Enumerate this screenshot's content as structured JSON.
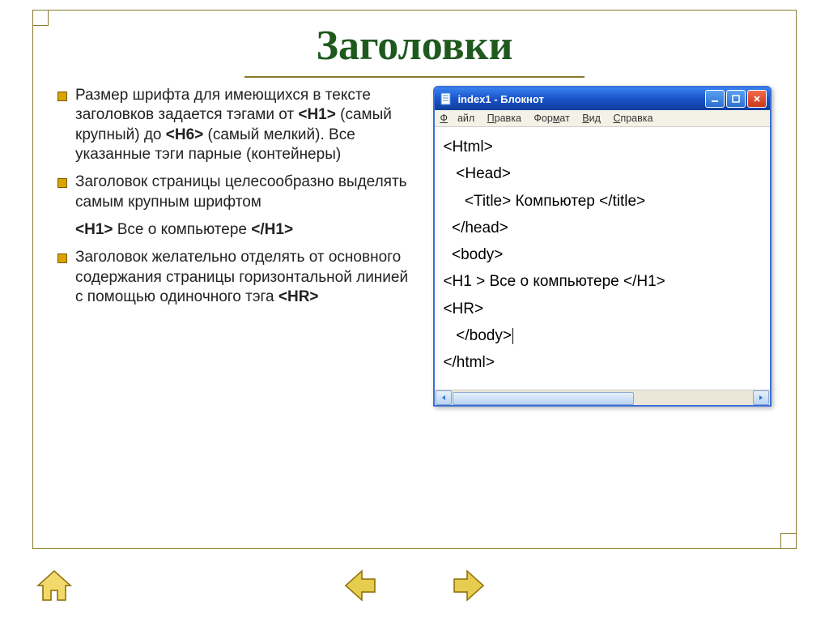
{
  "slide": {
    "title": "Заголовки"
  },
  "bullets": {
    "b1_pre": "Размер шрифта для имеющихся в тексте заголовков задается тэгами от ",
    "b1_tag1": "<H1>",
    "b1_mid": " (самый крупный) до ",
    "b1_tag2": "<H6>",
    "b1_post": " (самый мелкий). Все указанные тэги парные (контейнеры)",
    "b2": "Заголовок страницы целесообразно выделять самым крупным шрифтом",
    "ex_open": "<H1>",
    "ex_text": " Все о компьютере ",
    "ex_close": "</H1>",
    "b3_pre": "Заголовок желательно отделять от основного содержания страницы горизонтальной линией с помощью одиночного тэга ",
    "b3_tag": "<HR>"
  },
  "notepad": {
    "title": "index1 - Блокнот",
    "menu": {
      "file": "Файл",
      "edit": "Правка",
      "format": "Формат",
      "view": "Вид",
      "help": "Справка"
    },
    "lines": {
      "l1": "<Html>",
      "l2": "   <Head>",
      "l3": "     <Title> Компьютер </title>",
      "l4": "  </head>",
      "l5": "  <body>",
      "l6": "<H1 > Все о компьютере </H1>",
      "l7": "<HR>",
      "l8": "   </body>",
      "l9": "</html>"
    }
  },
  "nav": {
    "home": "home-icon",
    "prev": "prev-icon",
    "next": "next-icon"
  }
}
